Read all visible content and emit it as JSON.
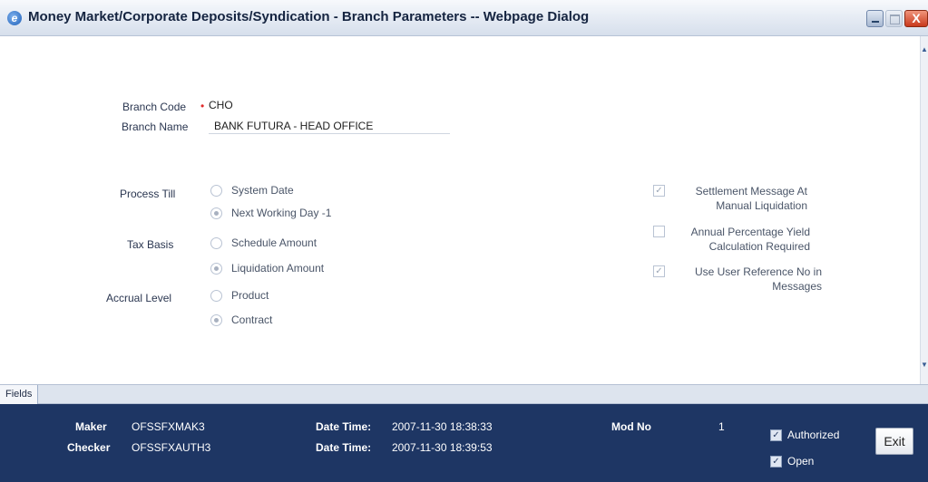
{
  "window": {
    "title": "Money Market/Corporate Deposits/Syndication - Branch Parameters -- Webpage Dialog",
    "icon": "ie-icon",
    "close_glyph": "X"
  },
  "branch": {
    "code_label": "Branch Code",
    "code_value": "CHO",
    "name_label": "Branch Name",
    "name_value": "BANK FUTURA - HEAD OFFICE"
  },
  "process_till": {
    "label": "Process Till",
    "options": [
      {
        "label": "System Date",
        "checked": false
      },
      {
        "label": "Next Working Day -1",
        "checked": true
      }
    ]
  },
  "tax_basis": {
    "label": "Tax Basis",
    "options": [
      {
        "label": "Schedule Amount",
        "checked": false
      },
      {
        "label": "Liquidation Amount",
        "checked": true
      }
    ]
  },
  "accrual_level": {
    "label": "Accrual Level",
    "options": [
      {
        "label": "Product",
        "checked": false
      },
      {
        "label": "Contract",
        "checked": true
      }
    ]
  },
  "checkboxes": [
    {
      "line1": "Settlement Message At",
      "line2": "Manual Liquidation",
      "checked": true
    },
    {
      "line1": "Annual Percentage Yield",
      "line2": "Calculation Required",
      "checked": false
    },
    {
      "line1": "Use User Reference No in",
      "line2": "Messages",
      "checked": true
    }
  ],
  "tabs": {
    "fields": "Fields"
  },
  "footer": {
    "maker_label": "Maker",
    "maker_value": "OFSSFXMAK3",
    "checker_label": "Checker",
    "checker_value": "OFSSFXAUTH3",
    "maker_datetime_label": "Date Time:",
    "maker_datetime_value": "2007-11-30 18:38:33",
    "checker_datetime_label": "Date Time:",
    "checker_datetime_value": "2007-11-30 18:39:53",
    "mod_no_label": "Mod No",
    "mod_no_value": "1",
    "authorized_label": "Authorized",
    "authorized_checked": true,
    "open_label": "Open",
    "open_checked": true,
    "exit_label": "Exit"
  },
  "colors": {
    "footer_bg": "#1e3664",
    "required_star": "#e02a2a",
    "title_text": "#152440"
  }
}
